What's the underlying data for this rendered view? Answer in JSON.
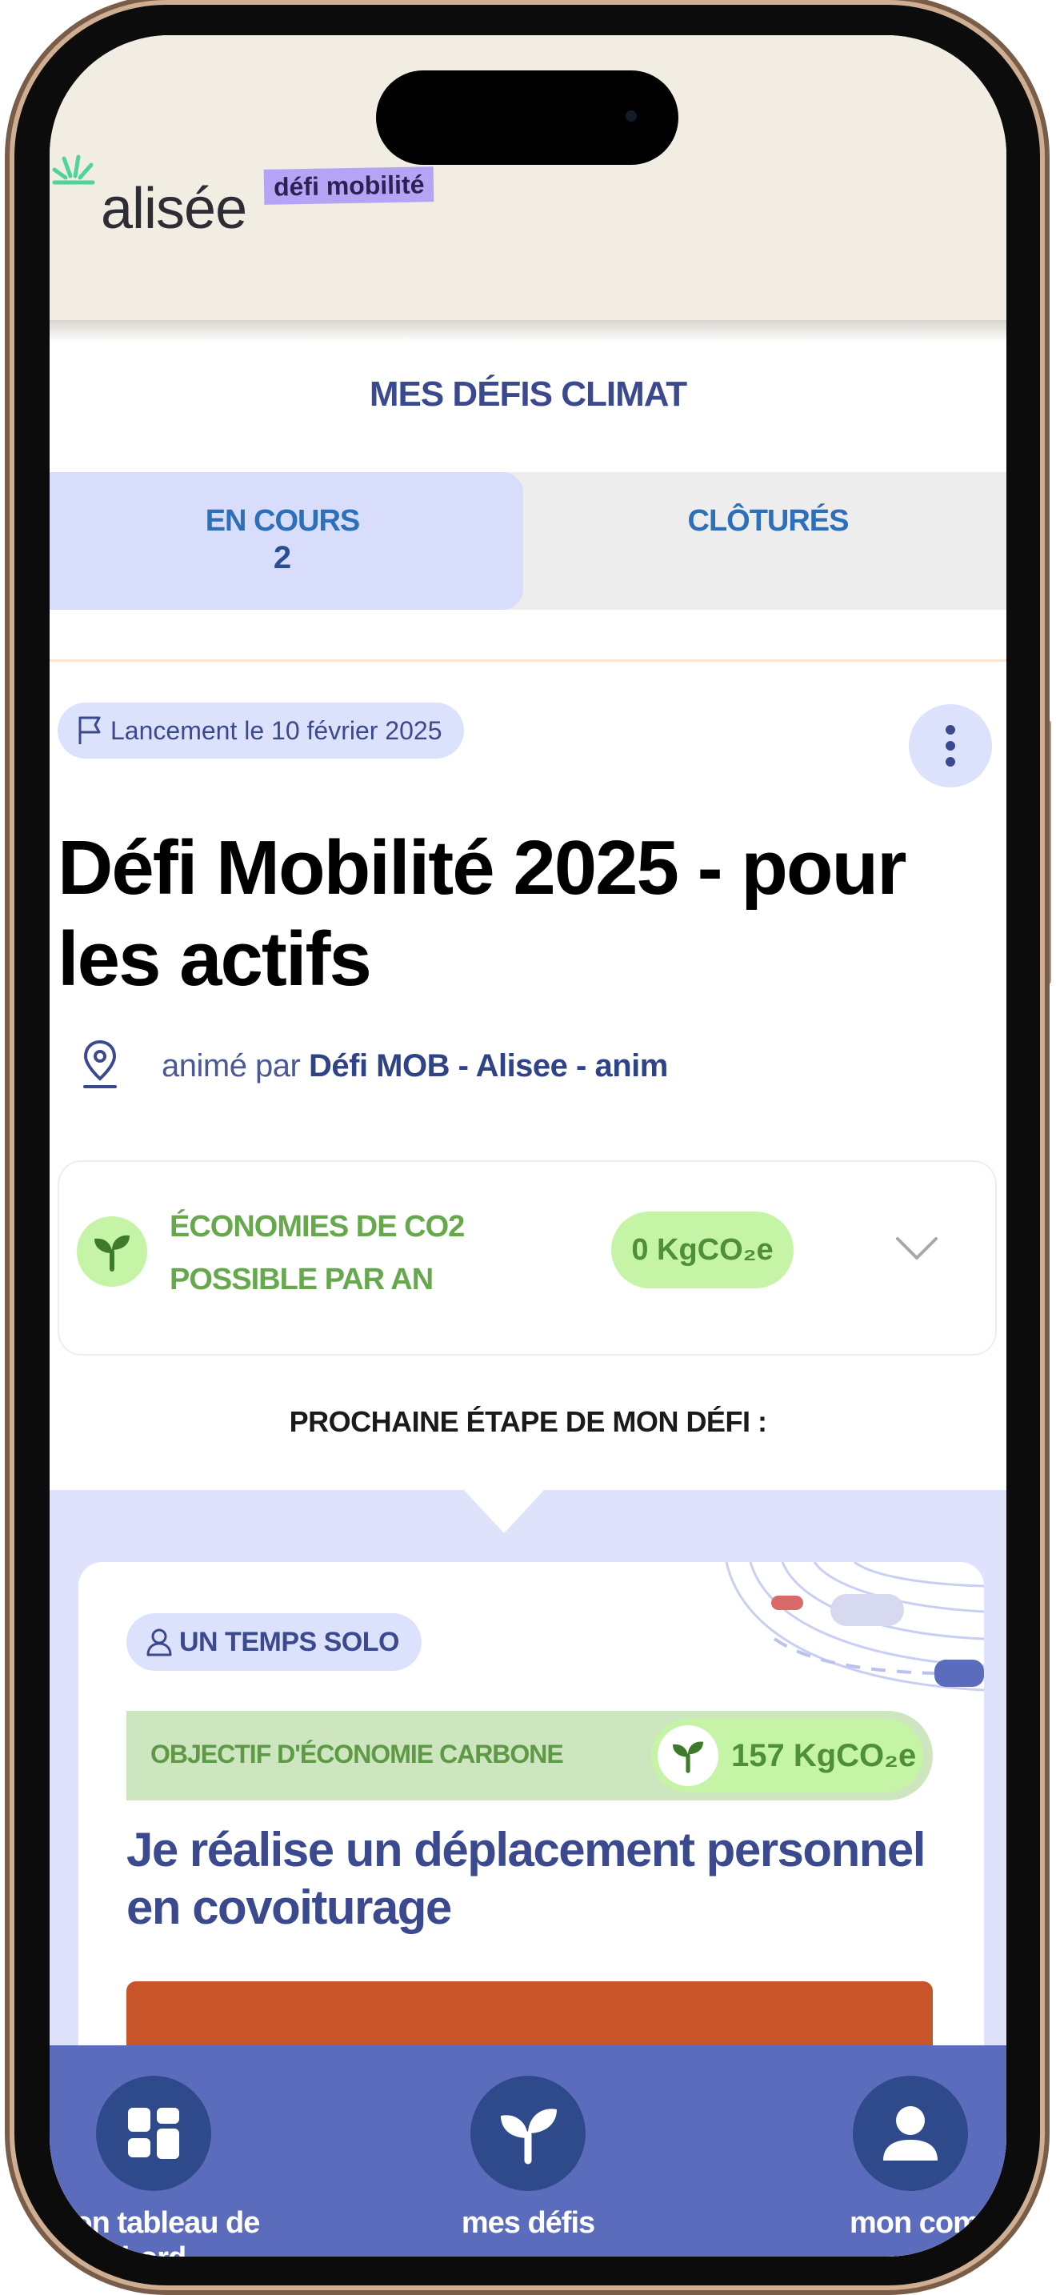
{
  "header": {
    "logo_text": "alisée",
    "logo_tag": "défi mobilité"
  },
  "page": {
    "title": "MES DÉFIS CLIMAT"
  },
  "tabs": [
    {
      "label": "EN COURS",
      "count": "2"
    },
    {
      "label": "CLÔTURÉS"
    }
  ],
  "challenge": {
    "launch_text": "Lancement le 10 février 2025",
    "title": "Défi Mobilité 2025 - pour les actifs",
    "animated_by_prefix": "animé par",
    "animated_by": "Défi MOB - Alisee - anim",
    "co2_label_line1": "ÉCONOMIES DE CO2",
    "co2_label_line2": "POSSIBLE PAR AN",
    "co2_value": "0 KgCO₂e"
  },
  "next_step": {
    "heading": "PROCHAINE ÉTAPE DE MON DÉFI :",
    "type_label": "UN TEMPS SOLO",
    "objective_label": "OBJECTIF D'ÉCONOMIE CARBONE",
    "objective_value": "157 KgCO₂e",
    "title": "Je réalise un déplacement personnel en covoiturage"
  },
  "bottom_nav": [
    {
      "label": "mon tableau de bord",
      "icon": "dashboard-icon"
    },
    {
      "label": "mes défis",
      "icon": "sprout-icon"
    },
    {
      "label": "mon compte",
      "icon": "user-icon"
    }
  ],
  "colors": {
    "brand_blue": "#3b4a8e",
    "nav_background": "#5c6cbd",
    "co2_green": "#c5f4a6",
    "cta_orange": "#c8552a"
  }
}
